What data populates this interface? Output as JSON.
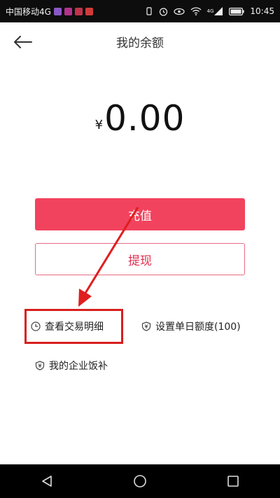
{
  "status_bar": {
    "carrier": "中国移动4G",
    "time": "10:45",
    "network_badge": "4G"
  },
  "header": {
    "title": "我的余额"
  },
  "balance": {
    "currency": "¥",
    "amount": "0.00"
  },
  "actions": {
    "recharge_label": "充值",
    "withdraw_label": "提现"
  },
  "links": {
    "history_label": "查看交易明细",
    "limit_label": "设置单日额度(100)",
    "meal_label": "我的企业饭补"
  },
  "colors": {
    "accent": "#f2435e",
    "highlight": "#d81e1e"
  }
}
